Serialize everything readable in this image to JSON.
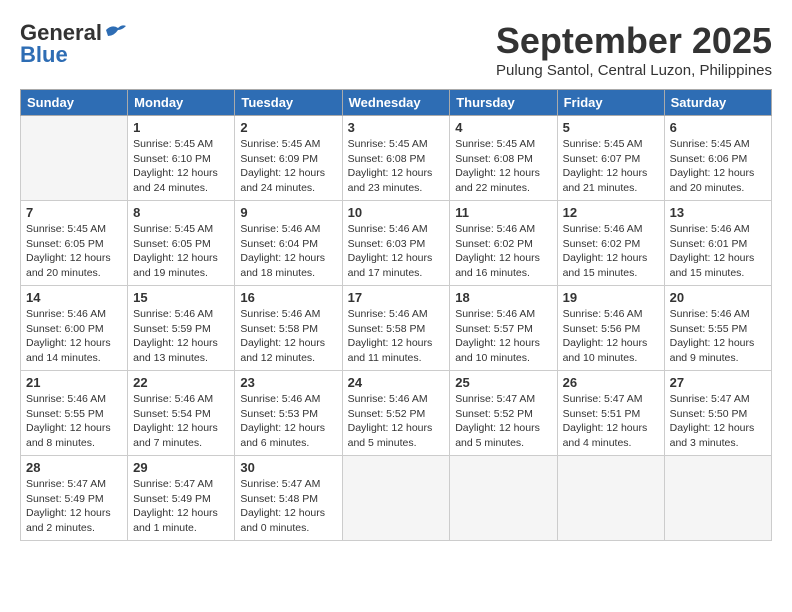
{
  "header": {
    "logo_general": "General",
    "logo_blue": "Blue",
    "month_title": "September 2025",
    "subtitle": "Pulung Santol, Central Luzon, Philippines"
  },
  "days_of_week": [
    "Sunday",
    "Monday",
    "Tuesday",
    "Wednesday",
    "Thursday",
    "Friday",
    "Saturday"
  ],
  "weeks": [
    [
      {
        "day": "",
        "info": ""
      },
      {
        "day": "1",
        "info": "Sunrise: 5:45 AM\nSunset: 6:10 PM\nDaylight: 12 hours\nand 24 minutes."
      },
      {
        "day": "2",
        "info": "Sunrise: 5:45 AM\nSunset: 6:09 PM\nDaylight: 12 hours\nand 24 minutes."
      },
      {
        "day": "3",
        "info": "Sunrise: 5:45 AM\nSunset: 6:08 PM\nDaylight: 12 hours\nand 23 minutes."
      },
      {
        "day": "4",
        "info": "Sunrise: 5:45 AM\nSunset: 6:08 PM\nDaylight: 12 hours\nand 22 minutes."
      },
      {
        "day": "5",
        "info": "Sunrise: 5:45 AM\nSunset: 6:07 PM\nDaylight: 12 hours\nand 21 minutes."
      },
      {
        "day": "6",
        "info": "Sunrise: 5:45 AM\nSunset: 6:06 PM\nDaylight: 12 hours\nand 20 minutes."
      }
    ],
    [
      {
        "day": "7",
        "info": "Sunrise: 5:45 AM\nSunset: 6:05 PM\nDaylight: 12 hours\nand 20 minutes."
      },
      {
        "day": "8",
        "info": "Sunrise: 5:45 AM\nSunset: 6:05 PM\nDaylight: 12 hours\nand 19 minutes."
      },
      {
        "day": "9",
        "info": "Sunrise: 5:46 AM\nSunset: 6:04 PM\nDaylight: 12 hours\nand 18 minutes."
      },
      {
        "day": "10",
        "info": "Sunrise: 5:46 AM\nSunset: 6:03 PM\nDaylight: 12 hours\nand 17 minutes."
      },
      {
        "day": "11",
        "info": "Sunrise: 5:46 AM\nSunset: 6:02 PM\nDaylight: 12 hours\nand 16 minutes."
      },
      {
        "day": "12",
        "info": "Sunrise: 5:46 AM\nSunset: 6:02 PM\nDaylight: 12 hours\nand 15 minutes."
      },
      {
        "day": "13",
        "info": "Sunrise: 5:46 AM\nSunset: 6:01 PM\nDaylight: 12 hours\nand 15 minutes."
      }
    ],
    [
      {
        "day": "14",
        "info": "Sunrise: 5:46 AM\nSunset: 6:00 PM\nDaylight: 12 hours\nand 14 minutes."
      },
      {
        "day": "15",
        "info": "Sunrise: 5:46 AM\nSunset: 5:59 PM\nDaylight: 12 hours\nand 13 minutes."
      },
      {
        "day": "16",
        "info": "Sunrise: 5:46 AM\nSunset: 5:58 PM\nDaylight: 12 hours\nand 12 minutes."
      },
      {
        "day": "17",
        "info": "Sunrise: 5:46 AM\nSunset: 5:58 PM\nDaylight: 12 hours\nand 11 minutes."
      },
      {
        "day": "18",
        "info": "Sunrise: 5:46 AM\nSunset: 5:57 PM\nDaylight: 12 hours\nand 10 minutes."
      },
      {
        "day": "19",
        "info": "Sunrise: 5:46 AM\nSunset: 5:56 PM\nDaylight: 12 hours\nand 10 minutes."
      },
      {
        "day": "20",
        "info": "Sunrise: 5:46 AM\nSunset: 5:55 PM\nDaylight: 12 hours\nand 9 minutes."
      }
    ],
    [
      {
        "day": "21",
        "info": "Sunrise: 5:46 AM\nSunset: 5:55 PM\nDaylight: 12 hours\nand 8 minutes."
      },
      {
        "day": "22",
        "info": "Sunrise: 5:46 AM\nSunset: 5:54 PM\nDaylight: 12 hours\nand 7 minutes."
      },
      {
        "day": "23",
        "info": "Sunrise: 5:46 AM\nSunset: 5:53 PM\nDaylight: 12 hours\nand 6 minutes."
      },
      {
        "day": "24",
        "info": "Sunrise: 5:46 AM\nSunset: 5:52 PM\nDaylight: 12 hours\nand 5 minutes."
      },
      {
        "day": "25",
        "info": "Sunrise: 5:47 AM\nSunset: 5:52 PM\nDaylight: 12 hours\nand 5 minutes."
      },
      {
        "day": "26",
        "info": "Sunrise: 5:47 AM\nSunset: 5:51 PM\nDaylight: 12 hours\nand 4 minutes."
      },
      {
        "day": "27",
        "info": "Sunrise: 5:47 AM\nSunset: 5:50 PM\nDaylight: 12 hours\nand 3 minutes."
      }
    ],
    [
      {
        "day": "28",
        "info": "Sunrise: 5:47 AM\nSunset: 5:49 PM\nDaylight: 12 hours\nand 2 minutes."
      },
      {
        "day": "29",
        "info": "Sunrise: 5:47 AM\nSunset: 5:49 PM\nDaylight: 12 hours\nand 1 minute."
      },
      {
        "day": "30",
        "info": "Sunrise: 5:47 AM\nSunset: 5:48 PM\nDaylight: 12 hours\nand 0 minutes."
      },
      {
        "day": "",
        "info": ""
      },
      {
        "day": "",
        "info": ""
      },
      {
        "day": "",
        "info": ""
      },
      {
        "day": "",
        "info": ""
      }
    ]
  ]
}
